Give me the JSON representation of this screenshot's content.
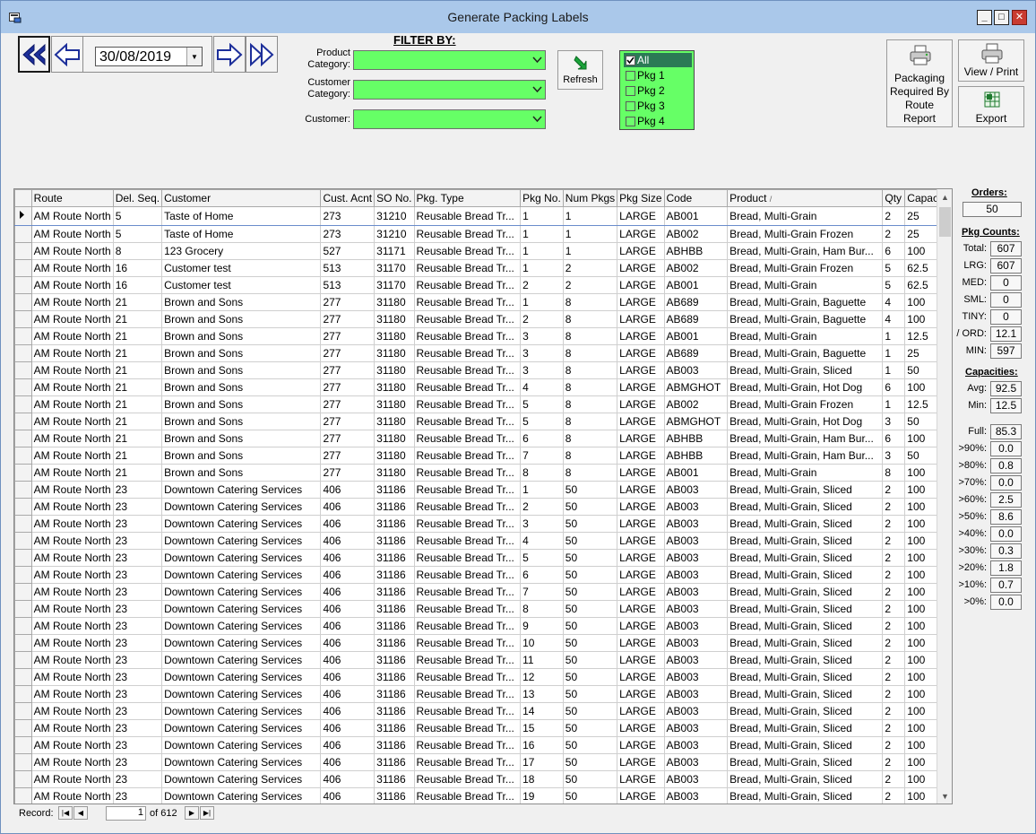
{
  "window": {
    "title": "Generate Packing Labels",
    "minimize": "_",
    "maximize": "□",
    "close": "✕"
  },
  "nav": {
    "date": "30/08/2019"
  },
  "filter": {
    "title": "FILTER BY:",
    "product_category_label": "Product Category:",
    "customer_category_label": "Customer Category:",
    "customer_label": "Customer:",
    "product_category_value": "",
    "customer_category_value": "",
    "customer_value": ""
  },
  "refresh": {
    "label": "Refresh"
  },
  "pkg_list": [
    {
      "label": "All",
      "checked": true,
      "selected": true
    },
    {
      "label": "Pkg 1",
      "checked": false,
      "selected": false
    },
    {
      "label": "Pkg 2",
      "checked": false,
      "selected": false
    },
    {
      "label": "Pkg 3",
      "checked": false,
      "selected": false
    },
    {
      "label": "Pkg 4",
      "checked": false,
      "selected": false
    }
  ],
  "buttons": {
    "report": "Packaging Required By Route Report",
    "view_print": "View / Print",
    "export": "Export"
  },
  "grid": {
    "sort_indicator": "/",
    "columns": [
      "Route",
      "Del. Seq.",
      "Customer",
      "Cust. Acnt",
      "SO No.",
      "Pkg. Type",
      "Pkg No.",
      "Num Pkgs",
      "Pkg Size",
      "Code",
      "Product",
      "Qty",
      "Capacity"
    ],
    "rows": [
      [
        "AM Route North",
        "5",
        "Taste of Home",
        "273",
        "31210",
        "Reusable Bread Tr...",
        "1",
        "1",
        "LARGE",
        "AB001",
        "Bread, Multi-Grain",
        "2",
        "25"
      ],
      [
        "AM Route North",
        "5",
        "Taste of Home",
        "273",
        "31210",
        "Reusable Bread Tr...",
        "1",
        "1",
        "LARGE",
        "AB002",
        "Bread, Multi-Grain Frozen",
        "2",
        "25"
      ],
      [
        "AM Route North",
        "8",
        "123 Grocery",
        "527",
        "31171",
        "Reusable Bread Tr...",
        "1",
        "1",
        "LARGE",
        "ABHBB",
        "Bread, Multi-Grain, Ham Bur...",
        "6",
        "100"
      ],
      [
        "AM Route North",
        "16",
        "Customer test",
        "513",
        "31170",
        "Reusable Bread Tr...",
        "1",
        "2",
        "LARGE",
        "AB002",
        "Bread, Multi-Grain Frozen",
        "5",
        "62.5"
      ],
      [
        "AM Route North",
        "16",
        "Customer test",
        "513",
        "31170",
        "Reusable Bread Tr...",
        "2",
        "2",
        "LARGE",
        "AB001",
        "Bread, Multi-Grain",
        "5",
        "62.5"
      ],
      [
        "AM Route North",
        "21",
        "Brown and Sons",
        "277",
        "31180",
        "Reusable Bread Tr...",
        "1",
        "8",
        "LARGE",
        "AB689",
        "Bread, Multi-Grain, Baguette",
        "4",
        "100"
      ],
      [
        "AM Route North",
        "21",
        "Brown and Sons",
        "277",
        "31180",
        "Reusable Bread Tr...",
        "2",
        "8",
        "LARGE",
        "AB689",
        "Bread, Multi-Grain, Baguette",
        "4",
        "100"
      ],
      [
        "AM Route North",
        "21",
        "Brown and Sons",
        "277",
        "31180",
        "Reusable Bread Tr...",
        "3",
        "8",
        "LARGE",
        "AB001",
        "Bread, Multi-Grain",
        "1",
        "12.5"
      ],
      [
        "AM Route North",
        "21",
        "Brown and Sons",
        "277",
        "31180",
        "Reusable Bread Tr...",
        "3",
        "8",
        "LARGE",
        "AB689",
        "Bread, Multi-Grain, Baguette",
        "1",
        "25"
      ],
      [
        "AM Route North",
        "21",
        "Brown and Sons",
        "277",
        "31180",
        "Reusable Bread Tr...",
        "3",
        "8",
        "LARGE",
        "AB003",
        "Bread, Multi-Grain, Sliced",
        "1",
        "50"
      ],
      [
        "AM Route North",
        "21",
        "Brown and Sons",
        "277",
        "31180",
        "Reusable Bread Tr...",
        "4",
        "8",
        "LARGE",
        "ABMGHOT",
        "Bread, Multi-Grain, Hot Dog",
        "6",
        "100"
      ],
      [
        "AM Route North",
        "21",
        "Brown and Sons",
        "277",
        "31180",
        "Reusable Bread Tr...",
        "5",
        "8",
        "LARGE",
        "AB002",
        "Bread, Multi-Grain Frozen",
        "1",
        "12.5"
      ],
      [
        "AM Route North",
        "21",
        "Brown and Sons",
        "277",
        "31180",
        "Reusable Bread Tr...",
        "5",
        "8",
        "LARGE",
        "ABMGHOT",
        "Bread, Multi-Grain, Hot Dog",
        "3",
        "50"
      ],
      [
        "AM Route North",
        "21",
        "Brown and Sons",
        "277",
        "31180",
        "Reusable Bread Tr...",
        "6",
        "8",
        "LARGE",
        "ABHBB",
        "Bread, Multi-Grain, Ham Bur...",
        "6",
        "100"
      ],
      [
        "AM Route North",
        "21",
        "Brown and Sons",
        "277",
        "31180",
        "Reusable Bread Tr...",
        "7",
        "8",
        "LARGE",
        "ABHBB",
        "Bread, Multi-Grain, Ham Bur...",
        "3",
        "50"
      ],
      [
        "AM Route North",
        "21",
        "Brown and Sons",
        "277",
        "31180",
        "Reusable Bread Tr...",
        "8",
        "8",
        "LARGE",
        "AB001",
        "Bread, Multi-Grain",
        "8",
        "100"
      ],
      [
        "AM Route North",
        "23",
        "Downtown Catering Services",
        "406",
        "31186",
        "Reusable Bread Tr...",
        "1",
        "50",
        "LARGE",
        "AB003",
        "Bread, Multi-Grain, Sliced",
        "2",
        "100"
      ],
      [
        "AM Route North",
        "23",
        "Downtown Catering Services",
        "406",
        "31186",
        "Reusable Bread Tr...",
        "2",
        "50",
        "LARGE",
        "AB003",
        "Bread, Multi-Grain, Sliced",
        "2",
        "100"
      ],
      [
        "AM Route North",
        "23",
        "Downtown Catering Services",
        "406",
        "31186",
        "Reusable Bread Tr...",
        "3",
        "50",
        "LARGE",
        "AB003",
        "Bread, Multi-Grain, Sliced",
        "2",
        "100"
      ],
      [
        "AM Route North",
        "23",
        "Downtown Catering Services",
        "406",
        "31186",
        "Reusable Bread Tr...",
        "4",
        "50",
        "LARGE",
        "AB003",
        "Bread, Multi-Grain, Sliced",
        "2",
        "100"
      ],
      [
        "AM Route North",
        "23",
        "Downtown Catering Services",
        "406",
        "31186",
        "Reusable Bread Tr...",
        "5",
        "50",
        "LARGE",
        "AB003",
        "Bread, Multi-Grain, Sliced",
        "2",
        "100"
      ],
      [
        "AM Route North",
        "23",
        "Downtown Catering Services",
        "406",
        "31186",
        "Reusable Bread Tr...",
        "6",
        "50",
        "LARGE",
        "AB003",
        "Bread, Multi-Grain, Sliced",
        "2",
        "100"
      ],
      [
        "AM Route North",
        "23",
        "Downtown Catering Services",
        "406",
        "31186",
        "Reusable Bread Tr...",
        "7",
        "50",
        "LARGE",
        "AB003",
        "Bread, Multi-Grain, Sliced",
        "2",
        "100"
      ],
      [
        "AM Route North",
        "23",
        "Downtown Catering Services",
        "406",
        "31186",
        "Reusable Bread Tr...",
        "8",
        "50",
        "LARGE",
        "AB003",
        "Bread, Multi-Grain, Sliced",
        "2",
        "100"
      ],
      [
        "AM Route North",
        "23",
        "Downtown Catering Services",
        "406",
        "31186",
        "Reusable Bread Tr...",
        "9",
        "50",
        "LARGE",
        "AB003",
        "Bread, Multi-Grain, Sliced",
        "2",
        "100"
      ],
      [
        "AM Route North",
        "23",
        "Downtown Catering Services",
        "406",
        "31186",
        "Reusable Bread Tr...",
        "10",
        "50",
        "LARGE",
        "AB003",
        "Bread, Multi-Grain, Sliced",
        "2",
        "100"
      ],
      [
        "AM Route North",
        "23",
        "Downtown Catering Services",
        "406",
        "31186",
        "Reusable Bread Tr...",
        "11",
        "50",
        "LARGE",
        "AB003",
        "Bread, Multi-Grain, Sliced",
        "2",
        "100"
      ],
      [
        "AM Route North",
        "23",
        "Downtown Catering Services",
        "406",
        "31186",
        "Reusable Bread Tr...",
        "12",
        "50",
        "LARGE",
        "AB003",
        "Bread, Multi-Grain, Sliced",
        "2",
        "100"
      ],
      [
        "AM Route North",
        "23",
        "Downtown Catering Services",
        "406",
        "31186",
        "Reusable Bread Tr...",
        "13",
        "50",
        "LARGE",
        "AB003",
        "Bread, Multi-Grain, Sliced",
        "2",
        "100"
      ],
      [
        "AM Route North",
        "23",
        "Downtown Catering Services",
        "406",
        "31186",
        "Reusable Bread Tr...",
        "14",
        "50",
        "LARGE",
        "AB003",
        "Bread, Multi-Grain, Sliced",
        "2",
        "100"
      ],
      [
        "AM Route North",
        "23",
        "Downtown Catering Services",
        "406",
        "31186",
        "Reusable Bread Tr...",
        "15",
        "50",
        "LARGE",
        "AB003",
        "Bread, Multi-Grain, Sliced",
        "2",
        "100"
      ],
      [
        "AM Route North",
        "23",
        "Downtown Catering Services",
        "406",
        "31186",
        "Reusable Bread Tr...",
        "16",
        "50",
        "LARGE",
        "AB003",
        "Bread, Multi-Grain, Sliced",
        "2",
        "100"
      ],
      [
        "AM Route North",
        "23",
        "Downtown Catering Services",
        "406",
        "31186",
        "Reusable Bread Tr...",
        "17",
        "50",
        "LARGE",
        "AB003",
        "Bread, Multi-Grain, Sliced",
        "2",
        "100"
      ],
      [
        "AM Route North",
        "23",
        "Downtown Catering Services",
        "406",
        "31186",
        "Reusable Bread Tr...",
        "18",
        "50",
        "LARGE",
        "AB003",
        "Bread, Multi-Grain, Sliced",
        "2",
        "100"
      ],
      [
        "AM Route North",
        "23",
        "Downtown Catering Services",
        "406",
        "31186",
        "Reusable Bread Tr...",
        "19",
        "50",
        "LARGE",
        "AB003",
        "Bread, Multi-Grain, Sliced",
        "2",
        "100"
      ]
    ]
  },
  "record_nav": {
    "label": "Record:",
    "current": "1",
    "of_text": "of 612"
  },
  "stats": {
    "orders_title": "Orders:",
    "orders": "50",
    "pkg_counts_title": "Pkg Counts:",
    "pkg_counts": [
      {
        "label": "Total:",
        "value": "607"
      },
      {
        "label": "LRG:",
        "value": "607"
      },
      {
        "label": "MED:",
        "value": "0"
      },
      {
        "label": "SML:",
        "value": "0"
      },
      {
        "label": "TINY:",
        "value": "0"
      },
      {
        "label": "/ ORD:",
        "value": "12.1"
      },
      {
        "label": "MIN:",
        "value": "597"
      }
    ],
    "capacities_title": "Capacities:",
    "capacities": [
      {
        "label": "Avg:",
        "value": "92.5"
      },
      {
        "label": "Min:",
        "value": "12.5"
      }
    ],
    "fill_levels": [
      {
        "label": "Full:",
        "value": "85.3"
      },
      {
        "label": ">90%:",
        "value": "0.0"
      },
      {
        "label": ">80%:",
        "value": "0.8"
      },
      {
        "label": ">70%:",
        "value": "0.0"
      },
      {
        "label": ">60%:",
        "value": "2.5"
      },
      {
        "label": ">50%:",
        "value": "8.6"
      },
      {
        "label": ">40%:",
        "value": "0.0"
      },
      {
        "label": ">30%:",
        "value": "0.3"
      },
      {
        "label": ">20%:",
        "value": "1.8"
      },
      {
        "label": ">10%:",
        "value": "0.7"
      },
      {
        "label": ">0%:",
        "value": "0.0"
      }
    ]
  },
  "colors": {
    "filter_green": "#66ff66",
    "title_bar": "#aac8ea",
    "selected_item": "#2b7a55"
  }
}
